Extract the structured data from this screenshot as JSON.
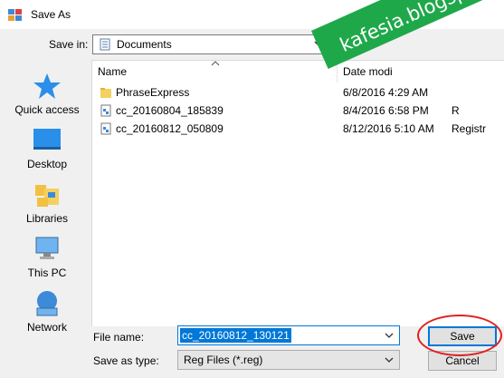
{
  "window": {
    "title": "Save As",
    "icon": "regedit-icon"
  },
  "save_in": {
    "label": "Save in:",
    "value": "Documents",
    "icon": "documents-folder-icon"
  },
  "places": [
    {
      "label": "Quick access",
      "icon": "star-icon"
    },
    {
      "label": "Desktop",
      "icon": "desktop-icon"
    },
    {
      "label": "Libraries",
      "icon": "libraries-icon"
    },
    {
      "label": "This PC",
      "icon": "computer-icon"
    },
    {
      "label": "Network",
      "icon": "network-icon"
    }
  ],
  "file_list": {
    "columns": [
      "Name",
      "Date modi"
    ],
    "rows": [
      {
        "name": "PhraseExpress",
        "date": "6/8/2016 4:29 AM",
        "type": "",
        "icon": "folder-icon"
      },
      {
        "name": "cc_20160804_185839",
        "date": "8/4/2016 6:58 PM",
        "type": "R",
        "icon": "reg-file-icon"
      },
      {
        "name": "cc_20160812_050809",
        "date": "8/12/2016 5:10 AM",
        "type": "Registr",
        "icon": "reg-file-icon"
      }
    ]
  },
  "file_name": {
    "label": "File name:",
    "value": "cc_20160812_130121"
  },
  "save_as_type": {
    "label": "Save as type:",
    "value": "Reg Files (*.reg)"
  },
  "buttons": {
    "save": "Save",
    "cancel": "Cancel"
  },
  "watermark": {
    "text": "kafesia.blogspot.co.id"
  },
  "colors": {
    "accent": "#0078d7",
    "banner": "#1fa84a",
    "annotation": "#e02020"
  }
}
